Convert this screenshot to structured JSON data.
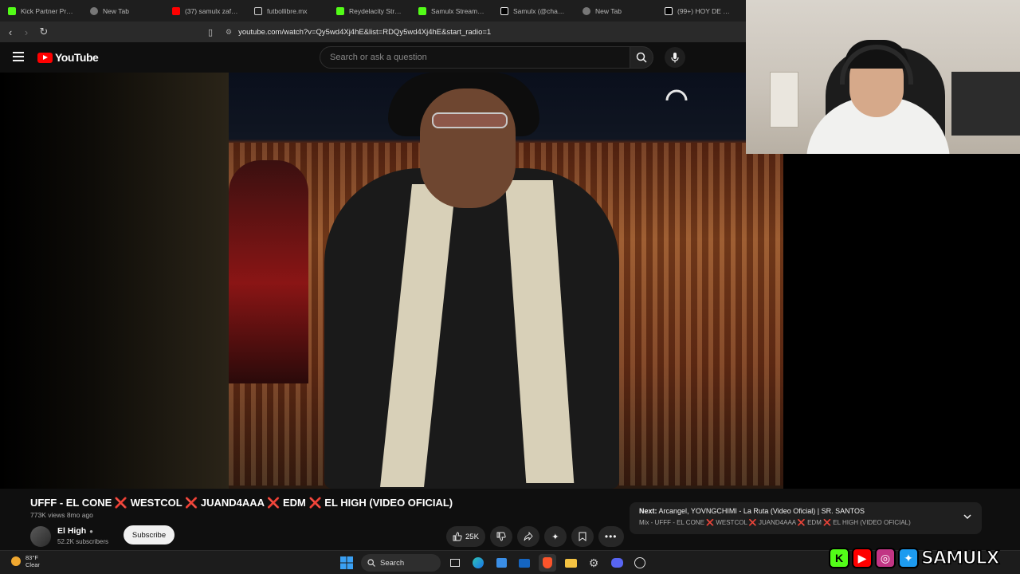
{
  "browser": {
    "tabs": [
      {
        "label": "Kick Partner Progr",
        "icon": "kick-icon",
        "color": "#53fc18"
      },
      {
        "label": "New Tab",
        "icon": "brave-icon",
        "color": "#bbbbbb"
      },
      {
        "label": "(37) samulx zaffiro",
        "icon": "youtube-icon",
        "color": "#ff0000"
      },
      {
        "label": "futbollibre.mx",
        "icon": "page-icon",
        "color": "#cccccc"
      },
      {
        "label": "Reydelacity Stream",
        "icon": "kick-icon",
        "color": "#53fc18"
      },
      {
        "label": "Samulx Stream - W",
        "icon": "kick-icon",
        "color": "#53fc18"
      },
      {
        "label": "Samulx (@chamuri",
        "icon": "tiktok-icon",
        "color": "#eeeeee"
      },
      {
        "label": "New Tab",
        "icon": "brave-icon",
        "color": "#bbbbbb"
      },
      {
        "label": "(99+) HOY DE NUE",
        "icon": "tiktok-icon",
        "color": "#eeeeee"
      }
    ],
    "url": "youtube.com/watch?v=Qy5wd4Xj4hE&list=RDQy5wd4Xj4hE&start_radio=1"
  },
  "youtube": {
    "logo_text": "YouTube",
    "search_placeholder": "Search or ask a question",
    "video": {
      "title": "UFFF - EL CONE ❌ WESTCOL ❌ JUAND4AAA ❌ EDM ❌ EL HIGH (VIDEO OFICIAL)",
      "stats": "773K views  8mo ago",
      "channel": "El High",
      "subscribers": "52.2K subscribers",
      "subscribe_label": "Subscribe",
      "likes": "25K"
    },
    "next": {
      "prefix": "Next:",
      "title": "Arcangel, YOVNGCHIMI - La Ruta (Video Oficial) | SR. SANTOS",
      "mix": "Mix - UFFF - EL CONE ❌ WESTCOL ❌ JUAND4AAA ❌ EDM ❌ EL HIGH (VIDEO OFICIAL)"
    }
  },
  "taskbar": {
    "temperature": "83°F",
    "condition": "Clear",
    "search_label": "Search"
  },
  "overlay": {
    "brand": "SAMULX"
  },
  "colors": {
    "accent": "#ff0000",
    "kick": "#53fc18",
    "instagram": "#c13584",
    "twitter": "#1d9bf0"
  }
}
